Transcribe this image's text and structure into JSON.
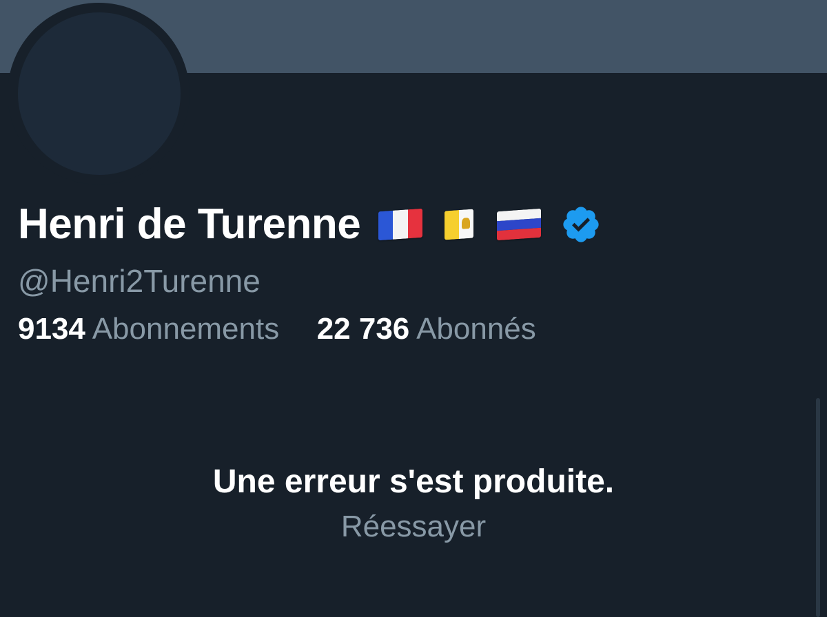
{
  "profile": {
    "display_name": "Henri de Turenne",
    "handle": "@Henri2Turenne",
    "flags": [
      "france-flag-icon",
      "vatican-flag-icon",
      "russia-flag-icon"
    ],
    "verified_icon": "verified-badge-icon"
  },
  "stats": {
    "following_count": "9134",
    "following_label": "Abonnements",
    "followers_count": "22 736",
    "followers_label": "Abonnés"
  },
  "error": {
    "message": "Une erreur s'est produite.",
    "retry_label": "Réessayer"
  },
  "colors": {
    "background": "#17202a",
    "banner": "#425466",
    "avatar": "#1d2a39",
    "primary_text": "#ffffff",
    "secondary_text": "#8899a6",
    "verified_blue": "#1d9bf0"
  }
}
